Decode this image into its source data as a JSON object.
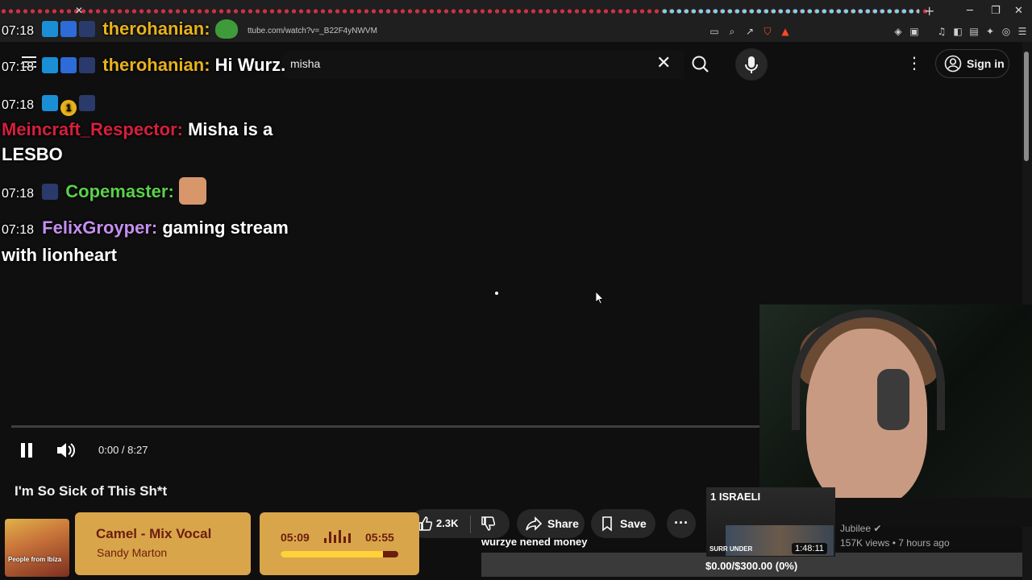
{
  "browser": {
    "url": "ttube.com/watch?v=_B22F4yNWVM"
  },
  "youtube": {
    "search_value": "misha",
    "sign_in_label": "Sign in",
    "video_title": "I'm So Sick of This Sh*t",
    "player_time": "0:00 / 8:27",
    "like_count": "2.3K",
    "share_label": "Share",
    "save_label": "Save"
  },
  "chat": [
    {
      "time": "07:18",
      "user": "therohanian",
      "text": ""
    },
    {
      "time": "07:18",
      "user": "therohanian",
      "text": "Hi Wurz."
    },
    {
      "time": "07:18",
      "user": "Meincraft_Respector",
      "text": "Misha is a",
      "text2": "LESBO"
    },
    {
      "time": "07:18",
      "user": "Copemaster",
      "text": ""
    },
    {
      "time": "07:18",
      "user": "FelixGroyper",
      "text": "gaming stream",
      "text2": "with lionheart"
    }
  ],
  "colors": {
    "therohanian": "#e8b21c",
    "Meincraft_Respector": "#d61f3c",
    "Copemaster": "#5ad14a",
    "FelixGroyper": "#c58ff0"
  },
  "now_playing": {
    "title": "Camel - Mix Vocal",
    "artist": "Sandy Marton",
    "elapsed": "05:09",
    "total": "05:55",
    "progress": 0.87,
    "art_text": "People from Ibiza"
  },
  "stream": {
    "donation_message": "wurzye nened money",
    "goal_text": "$0.00/$300.00 (0%)"
  },
  "suggestion": {
    "thumb_text": "1 ISRAELI",
    "thumb_sub": "SURR UNDER",
    "duration": "1:48:11",
    "channel": "Jubilee",
    "views": "157K views • 7 hours ago"
  }
}
